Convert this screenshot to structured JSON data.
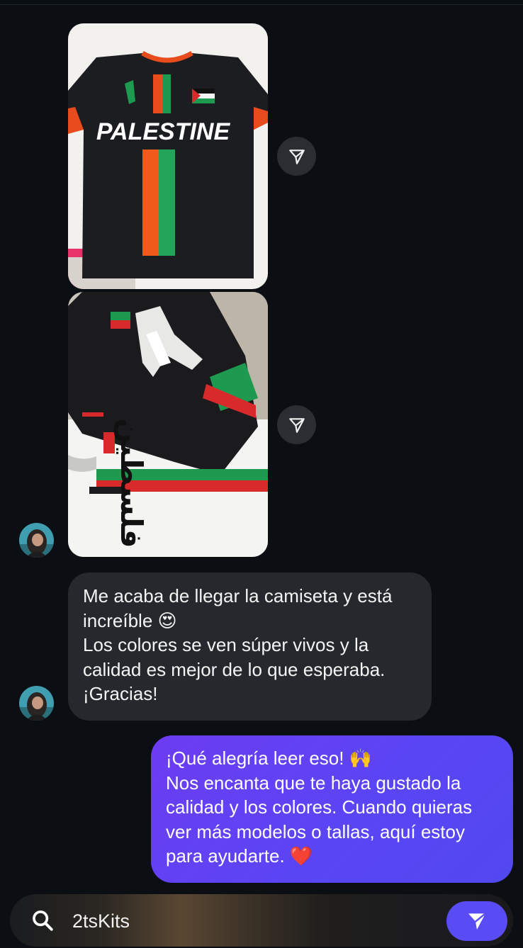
{
  "messages": {
    "incoming_text": "Me acaba de llegar la camiseta y está increíble 😍\nLos colores se ven súper vivos y la calidad es mejor de lo que esperaba. ¡Gracias!",
    "outgoing_text": "¡Qué alegría leer eso! 🙌\nNos encanta que te haya gustado la calidad y los colores. Cuando quieras ver más modelos o tallas, aquí estoy para ayudarte. ❤️"
  },
  "photo1": {
    "jersey_text": "PALESTINE"
  },
  "photo2": {
    "jersey_text": "فلسطين"
  },
  "composer": {
    "value": "2tsKits"
  },
  "icons": {
    "share": "send-share-icon",
    "search": "search-icon",
    "send": "send-icon"
  },
  "colors": {
    "background": "#0b0f14",
    "incoming_bubble": "#25282c",
    "outgoing_bubble": "#5a45f5",
    "send_button": "#5a4cf4"
  }
}
